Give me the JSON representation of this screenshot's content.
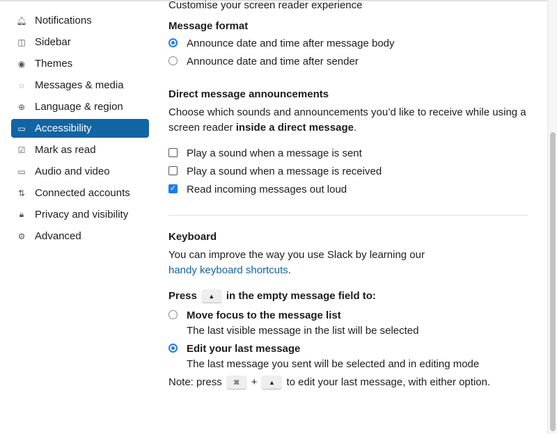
{
  "sidebar": {
    "items": [
      {
        "label": "Notifications",
        "icon": "bell-icon"
      },
      {
        "label": "Sidebar",
        "icon": "sidebar-icon"
      },
      {
        "label": "Themes",
        "icon": "eye-icon"
      },
      {
        "label": "Messages & media",
        "icon": "message-icon"
      },
      {
        "label": "Language & region",
        "icon": "globe-icon"
      },
      {
        "label": "Accessibility",
        "icon": "laptop-icon",
        "active": true
      },
      {
        "label": "Mark as read",
        "icon": "check-square-icon"
      },
      {
        "label": "Audio and video",
        "icon": "video-icon"
      },
      {
        "label": "Connected accounts",
        "icon": "arrows-icon"
      },
      {
        "label": "Privacy and visibility",
        "icon": "lock-icon"
      },
      {
        "label": "Advanced",
        "icon": "gear-icon"
      }
    ]
  },
  "main": {
    "intro": "Customise your screen reader experience",
    "message_format": {
      "title": "Message format",
      "options": [
        "Announce date and time after message body",
        "Announce date and time after sender"
      ],
      "selected": 0
    },
    "dm": {
      "title": "Direct message announcements",
      "desc1": "Choose which sounds and announcements you’d like to receive while using a",
      "desc2_pre": "screen reader ",
      "desc2_bold": "inside a direct message",
      "desc2_post": ".",
      "checks": [
        {
          "label": "Play a sound when a message is sent",
          "checked": false
        },
        {
          "label": "Play a sound when a message is received",
          "checked": false
        },
        {
          "label": "Read incoming messages out loud",
          "checked": true
        }
      ]
    },
    "keyboard": {
      "title": "Keyboard",
      "desc": "You can improve the way you use Slack by learning our",
      "link": "handy keyboard shortcuts",
      "link_post": ".",
      "press_pre": "Press",
      "press_key": "▲",
      "press_post": "in the empty message field to:",
      "options": [
        {
          "label": "Move focus to the message list",
          "sub": "The last visible message in the list will be selected"
        },
        {
          "label": "Edit your last message",
          "sub": "The last message you sent will be selected and in editing mode"
        }
      ],
      "selected": 1,
      "note_pre": "Note: press",
      "note_key1": "⌘",
      "note_plus": "+",
      "note_key2": "▲",
      "note_post": "to edit your last message, with either option."
    }
  },
  "colors": {
    "accent": "#1264a3",
    "radio": "#1d7cf2"
  }
}
